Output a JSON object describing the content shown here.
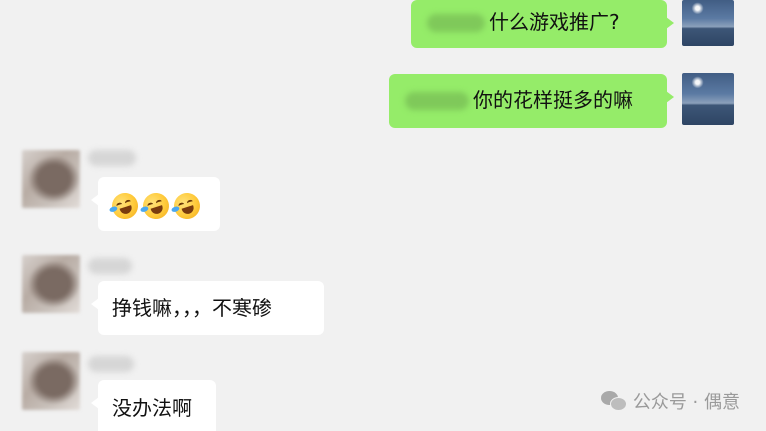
{
  "messages": [
    {
      "id": "m1",
      "direction": "sent",
      "mention_blurred": true,
      "text": "什么游戏推广?"
    },
    {
      "id": "m2",
      "direction": "sent",
      "mention_blurred": true,
      "text": "你的花样挺多的嘛"
    },
    {
      "id": "m3",
      "direction": "received",
      "emoji": [
        "laughing-tears",
        "laughing-tears",
        "laughing-tears"
      ]
    },
    {
      "id": "m4",
      "direction": "received",
      "text": "挣钱嘛，，，不寒碜"
    },
    {
      "id": "m5",
      "direction": "received",
      "text": "没办法啊"
    }
  ],
  "watermark": {
    "text": "公众号 · 偶意",
    "icon": "wechat-icon"
  },
  "colors": {
    "background": "#f1f1f1",
    "sent_bubble": "#95ec69",
    "received_bubble": "#ffffff",
    "watermark_text": "#9a9a9a"
  }
}
